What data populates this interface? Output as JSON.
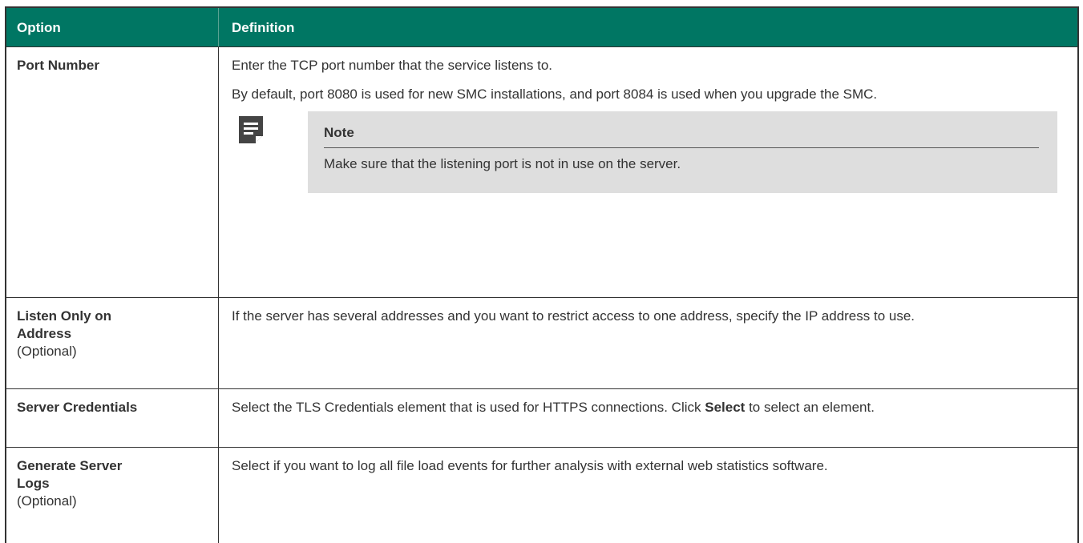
{
  "header": {
    "option": "Option",
    "definition": "Definition"
  },
  "rows": [
    {
      "option": "Port Number",
      "paragraphs": [
        "Enter the TCP port number that the service listens to.",
        "By default, port 8080 is used for new SMC installations, and port 8084 is used when you upgrade the SMC."
      ],
      "note": {
        "icon": "note-icon",
        "title": "Note",
        "text": "Make sure that the listening port is not in use on the server."
      }
    },
    {
      "option": "Listen Only on Address",
      "suffix": "(Optional)",
      "definition": "If the server has several addresses and you want to restrict access to one address, specify the IP address to use."
    },
    {
      "option": "Server Credentials",
      "definition_pre": "Select the TLS Credentials element that is used for HTTPS connections. Click ",
      "definition_bold": "Select",
      "definition_post": " to select an element."
    },
    {
      "option": "Generate Server Logs",
      "suffix": "(Optional)",
      "definition": "Select if you want to log all file load events for further analysis with external web statistics software."
    }
  ]
}
